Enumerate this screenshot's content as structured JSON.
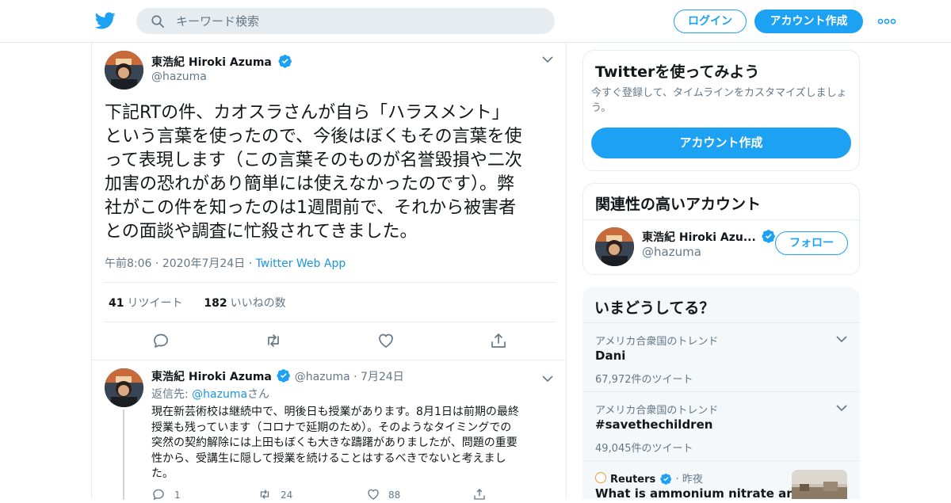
{
  "header": {
    "search_placeholder": "キーワード検索",
    "login_label": "ログイン",
    "signup_label": "アカウント作成"
  },
  "tweet": {
    "author_name": "東浩紀 Hiroki Azuma",
    "author_handle": "@hazuma",
    "text": "下記RTの件、カオスラさんが自ら「ハラスメント」\nという言葉を使ったので、今後はぼくもその言葉を使\nって表現します（この言葉そのものが名誉毀損や二次\n加害の恐れがあり簡単には使えなかったのです）。弊\n社がこの件を知ったのは1週間前で、それから被害者\nとの面談や調査に忙殺されてきました。",
    "time": "午前8:06",
    "date": "2020年7月24日",
    "source": "Twitter Web App",
    "retweet_count": "41",
    "retweet_label": "リツイート",
    "like_count": "182",
    "like_label": "いいねの数"
  },
  "reply": {
    "author_name": "東浩紀 Hiroki Azuma",
    "author_handle": "@hazuma",
    "date": "7月24日",
    "reply_to_prefix": "返信先: ",
    "reply_to_handle": "@hazuma",
    "reply_to_suffix": "さん",
    "text": "現在新芸術校は継続中で、明後日も授業があります。8月1日は前期の最終\n授業も残っています（コロナで延期のため）。そのようなタイミングでの\n突然の契約解除には上田もぼくも大きな躊躇がありましたが、問題の重要\n性から、受講生に隠して授業を続けることはするべきでないと考えまし\nた。",
    "reply_count": "1",
    "retweet_count": "24",
    "like_count": "88"
  },
  "sidebar": {
    "signup_card": {
      "title": "Twitterを使ってみよう",
      "description": "今すぐ登録して、タイムラインをカスタマイズしましょ\nう。",
      "button_label": "アカウント作成"
    },
    "related_card": {
      "title": "関連性の高いアカウント",
      "account_name": "東浩紀 Hiroki Azu...",
      "account_handle": "@hazuma",
      "follow_label": "フォロー"
    },
    "trends_card": {
      "title": "いまどうしてる？",
      "items": [
        {
          "location": "アメリカ合衆国のトレンド",
          "term": "Dani",
          "count": "67,972件のツイート"
        },
        {
          "location": "アメリカ合衆国のトレンド",
          "term": "#savethechildren",
          "count": "49,045件のツイート"
        }
      ],
      "news": {
        "source": "Reuters",
        "time": "昨夜",
        "headline": "What is ammonium nitrate and why"
      }
    }
  },
  "colors": {
    "brand": "#1da1f2",
    "verified": "#1da1f2",
    "muted_text": "#657786",
    "link": "#1b95e0"
  }
}
